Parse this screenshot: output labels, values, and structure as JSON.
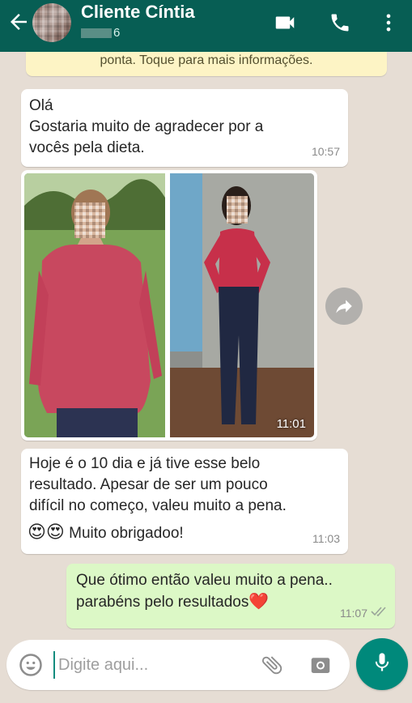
{
  "header": {
    "contact_name": "Cliente Cíntia",
    "status": "6"
  },
  "notice": "ponta. Toque para mais informações.",
  "messages": [
    {
      "direction": "in",
      "text": "Olá\nGostaria muito de agradecer por a\nvocês pela dieta.",
      "time": "10:57"
    },
    {
      "direction": "in",
      "type": "image",
      "time": "11:01"
    },
    {
      "direction": "in",
      "text": "Hoje é o 10 dia e já tive esse belo\nresultado. Apesar de ser um pouco\ndifícil no começo, valeu muito a pena.",
      "emoji": "😍😍",
      "emoji_text": " Muito obrigadoo!",
      "time": "11:03"
    },
    {
      "direction": "out",
      "text": "Que ótimo então valeu muito a pena..\nparabéns pelo resultados",
      "emoji": "❤️",
      "time": "11:07"
    }
  ],
  "input": {
    "placeholder": "Digite aqui..."
  },
  "colors": {
    "header": "#075e54",
    "chat_bg": "#e6ddd4",
    "incoming": "#ffffff",
    "outgoing": "#dcf8c6",
    "mic": "#00897b"
  },
  "icons": [
    "back-arrow-icon",
    "video-call-icon",
    "phone-icon",
    "more-vert-icon",
    "forward-icon",
    "emoji-icon",
    "attach-icon",
    "camera-icon",
    "mic-icon",
    "double-check-icon"
  ]
}
